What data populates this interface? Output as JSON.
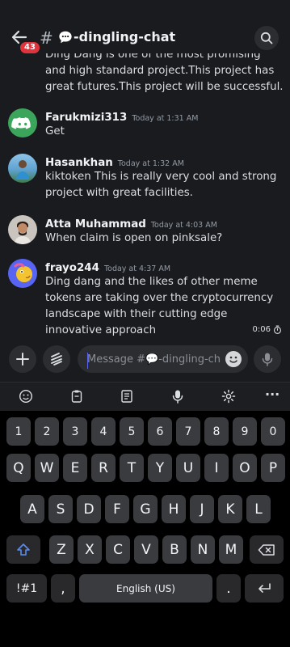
{
  "header": {
    "badge_count": "43",
    "hash_symbol": "#",
    "channel_name": "-dingling-chat",
    "chevron": "›",
    "icons": [
      "back-arrow-icon",
      "speech-bubble-icon",
      "search-icon"
    ]
  },
  "messages": {
    "previous_text": "Ding Dang is one of the most promising and high standard project.This project has great futures.This project will be successful.",
    "items": [
      {
        "username": "Farukmizi313",
        "time": "Today at 1:31 AM",
        "text": "Get",
        "avatar": "discord-logo-avatar",
        "avatar_color": "#3ba55c"
      },
      {
        "username": "Hasankhan",
        "time": "Today at 1:32 AM",
        "text": "kiktoken This is really very cool and strong project with great facilities.",
        "avatar": "photo-avatar",
        "avatar_color": "#4a8dbd"
      },
      {
        "username": "Atta Muhammad",
        "time": "Today at 4:03 AM",
        "text": "When claim is open on pinksale?",
        "avatar": "photo-avatar",
        "avatar_color": "#6b4f3f"
      },
      {
        "username": "frayo244",
        "time": "Today at 4:37 AM",
        "text": "Ding dang and the likes of other meme tokens are taking over the cryptocurrency landscape with their cutting edge innovative approach",
        "avatar": "cartoon-avatar",
        "avatar_color": "#5865f2"
      }
    ],
    "timer": "0:06"
  },
  "composer": {
    "placeholder": "Message #💬-dingling-ch...",
    "icons": [
      "plus-icon",
      "apps-icon",
      "emoji-icon",
      "microphone-icon"
    ]
  },
  "keyboard": {
    "toolbar_icons": [
      "emoji-icon",
      "clipboard-icon",
      "text-format-icon",
      "microphone-icon",
      "gear-icon",
      "more-icon"
    ],
    "more_label": "···",
    "row_numbers": [
      "1",
      "2",
      "3",
      "4",
      "5",
      "6",
      "7",
      "8",
      "9",
      "0"
    ],
    "row_top": [
      "Q",
      "W",
      "E",
      "R",
      "T",
      "Y",
      "U",
      "I",
      "O",
      "P"
    ],
    "row_middle": [
      "A",
      "S",
      "D",
      "F",
      "G",
      "H",
      "J",
      "K",
      "L"
    ],
    "row_bottom": [
      "Z",
      "X",
      "C",
      "V",
      "B",
      "N",
      "M"
    ],
    "symbols_key": "!#1",
    "comma_key": ",",
    "space_label": "English (US)",
    "period_key": ".",
    "colors": {
      "key": "#3a3b3f",
      "special_key": "#29292c",
      "accent": "#5865f2",
      "badge": "#e0333b"
    }
  }
}
